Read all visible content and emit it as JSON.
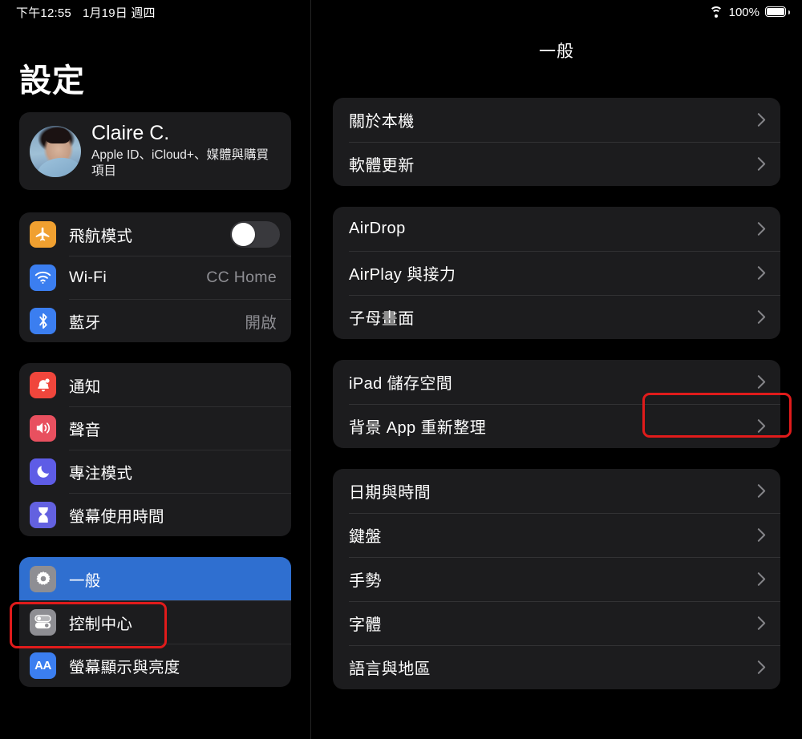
{
  "status_bar": {
    "time": "下午12:55",
    "date": "1月19日 週四",
    "wifi_icon": "wifi-icon",
    "battery_percent": "100%",
    "battery_icon": "battery-full-icon"
  },
  "sidebar": {
    "title": "設定",
    "account": {
      "name": "Claire C.",
      "subtitle": "Apple ID、iCloud+、媒體與購買項目",
      "avatar": "user-avatar-photo"
    },
    "groups": [
      {
        "items": [
          {
            "label": "飛航模式",
            "icon": "airplane-icon",
            "icon_color": "#f0a030",
            "control": "toggle",
            "toggle_on": false
          },
          {
            "label": "Wi-Fi",
            "icon": "wifi-icon",
            "icon_color": "#3b7ef0",
            "value": "CC Home"
          },
          {
            "label": "藍牙",
            "icon": "bluetooth-icon",
            "icon_color": "#3b7ef0",
            "value": "開啟"
          }
        ]
      },
      {
        "items": [
          {
            "label": "通知",
            "icon": "bell-icon",
            "icon_color": "#f0463c"
          },
          {
            "label": "聲音",
            "icon": "speaker-icon",
            "icon_color": "#e8505f"
          },
          {
            "label": "專注模式",
            "icon": "moon-icon",
            "icon_color": "#5e5ce6"
          },
          {
            "label": "螢幕使用時間",
            "icon": "hourglass-icon",
            "icon_color": "#6361e0"
          }
        ]
      },
      {
        "items": [
          {
            "label": "一般",
            "icon": "gear-icon",
            "icon_color": "#8e8e93",
            "selected": true
          },
          {
            "label": "控制中心",
            "icon": "control-center-icon",
            "icon_color": "#8e8e93"
          },
          {
            "label": "螢幕顯示與亮度",
            "icon": "display-aa-icon",
            "icon_color": "#3b7ef0"
          }
        ]
      }
    ]
  },
  "detail": {
    "title": "一般",
    "groups": [
      {
        "items": [
          {
            "label": "關於本機",
            "accessory": "chevron-right-icon"
          },
          {
            "label": "軟體更新",
            "accessory": "chevron-right-icon"
          }
        ]
      },
      {
        "items": [
          {
            "label": "AirDrop",
            "accessory": "chevron-right-icon"
          },
          {
            "label": "AirPlay 與接力",
            "accessory": "chevron-right-icon"
          },
          {
            "label": "子母畫面",
            "accessory": "chevron-right-icon"
          }
        ]
      },
      {
        "items": [
          {
            "label": "iPad 儲存空間",
            "accessory": "chevron-right-icon",
            "highlighted": true
          },
          {
            "label": "背景 App 重新整理",
            "accessory": "chevron-right-icon"
          }
        ]
      },
      {
        "items": [
          {
            "label": "日期與時間",
            "accessory": "chevron-right-icon"
          },
          {
            "label": "鍵盤",
            "accessory": "chevron-right-icon"
          },
          {
            "label": "手勢",
            "accessory": "chevron-right-icon"
          },
          {
            "label": "字體",
            "accessory": "chevron-right-icon"
          },
          {
            "label": "語言與地區",
            "accessory": "chevron-right-icon"
          }
        ]
      }
    ]
  },
  "annotations": {
    "color": "#e01b1b",
    "boxes": [
      {
        "target": "sidebar-item-general"
      },
      {
        "target": "detail-item-ipad-storage"
      }
    ]
  }
}
